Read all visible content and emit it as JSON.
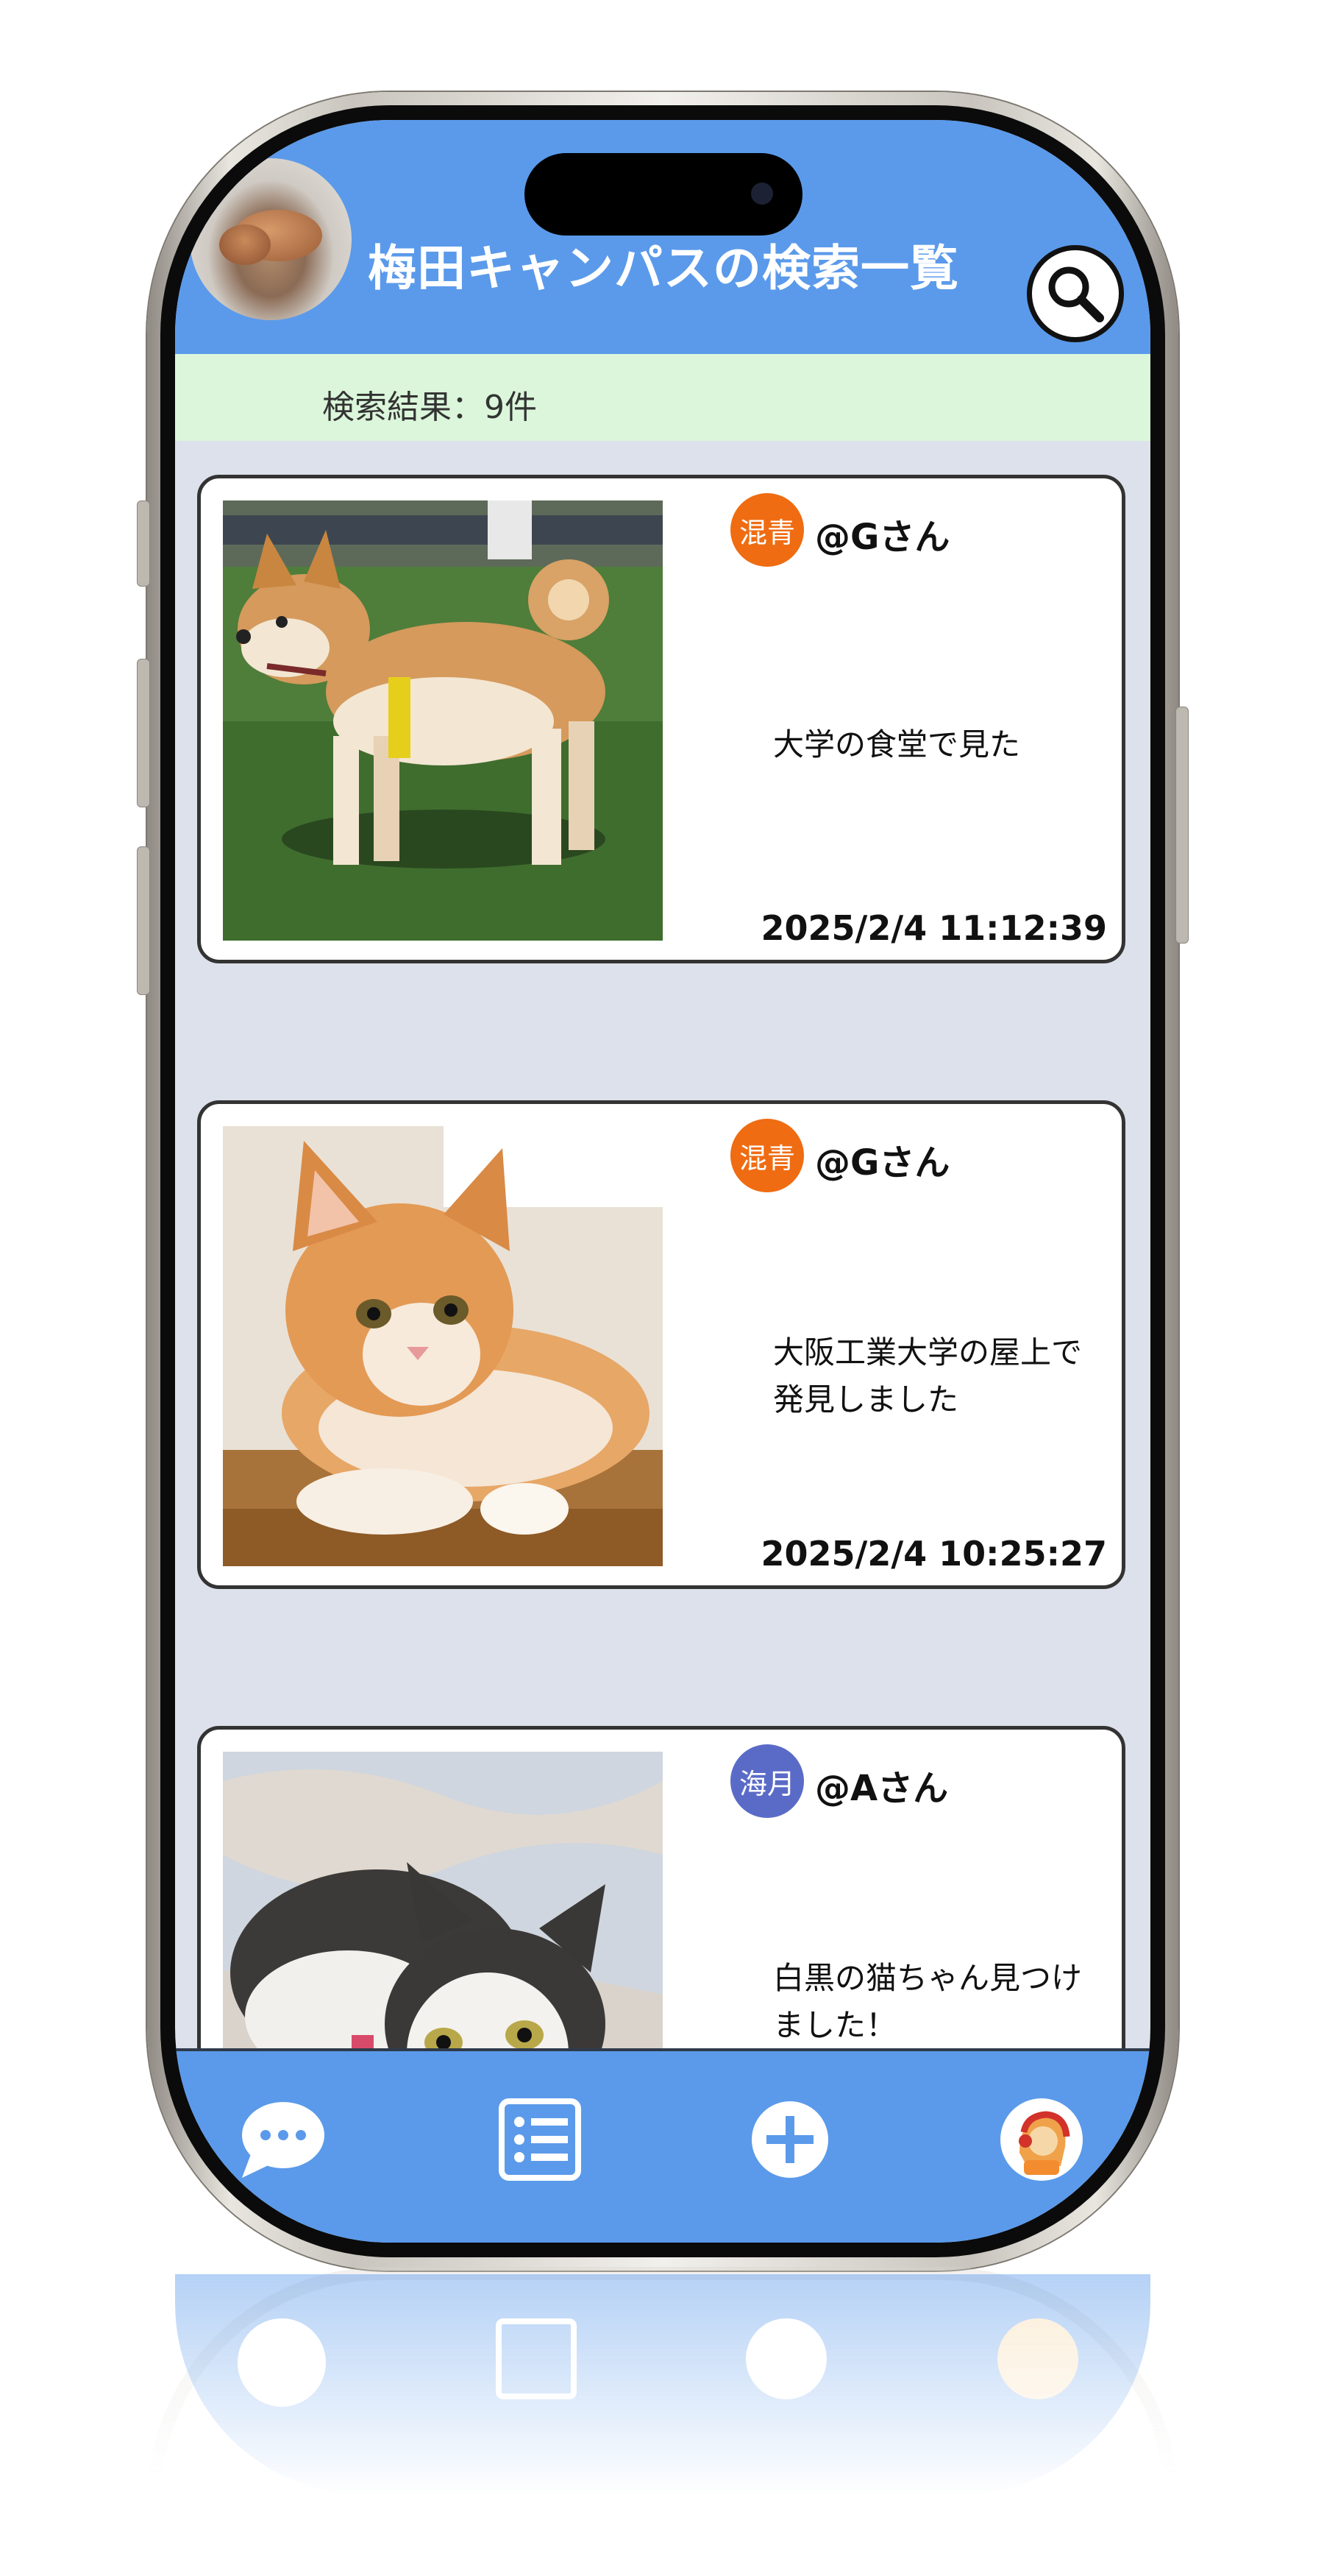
{
  "header": {
    "title": "梅田キャンパスの検索一覧"
  },
  "results": {
    "count_text": "検索結果：9件"
  },
  "posts": [
    {
      "badge": "混青",
      "badge_color": "#ef6c12",
      "user": "@Gさん",
      "text": "大学の食堂で見た",
      "time": "2025/2/4 11:12:39",
      "photo": "shiba-dog-photo"
    },
    {
      "badge": "混青",
      "badge_color": "#ef6c12",
      "user": "@Gさん",
      "text": "大阪工業大学の屋上で発見しました",
      "time": "2025/2/4 10:25:27",
      "photo": "orange-kitten-photo"
    },
    {
      "badge": "海月",
      "badge_color": "#5a6bc7",
      "user": "@Aさん",
      "text": "白黒の猫ちゃん見つけました！",
      "time": "",
      "photo": "black-white-cat-photo"
    }
  ],
  "nav": {
    "items": [
      "chat-icon",
      "list-icon",
      "add-icon",
      "profile-icon"
    ],
    "color": "#5b9aea"
  },
  "colors": {
    "header": "#5b9aea",
    "results_bar": "#dbf6da",
    "feed_bg": "#dde1eb"
  }
}
